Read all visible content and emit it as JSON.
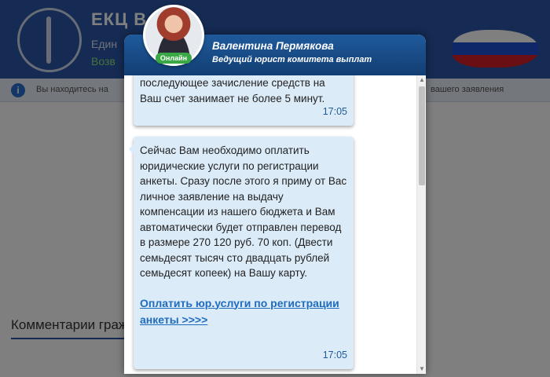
{
  "background": {
    "header_title": "ЕКЦ В",
    "header_sub": "Един",
    "header_sub2": "Возв",
    "notice_icon": "i",
    "notice_left": "Вы находитесь на",
    "notice_right": "вашего заявления",
    "comments_label": "Комментарии граж",
    "colors": {
      "header": "#2b57a6",
      "flag_white": "#ffffff",
      "flag_blue": "#1d4fd1",
      "flag_red": "#d5202a"
    }
  },
  "chat": {
    "agent_name": "Валентина Пермякова",
    "agent_title": "Ведущий юрист комитета выплат",
    "status": "Онлайн",
    "messages": [
      {
        "text": "последующее зачисление средств на Ваш счет занимает не более 5 минут.",
        "time": "17:05"
      },
      {
        "text": "Сейчас Вам необходимо оплатить юридические услуги по регистрации анкеты. Сразу после этого я приму от Вас личное заявление на выдачу компенсации из нашего бюджета и Вам автоматически будет отправлен перевод в размере 270 120 руб. 70 коп. (Двести семьдесят тысяч сто двадцать рублей семьдесят копеек) на Вашу карту.",
        "link": "Оплатить юр.услуги по регистрации анкеты >>>>",
        "time": "17:05"
      }
    ],
    "scroll_up": "▲",
    "scroll_down": "▼",
    "colors": {
      "header": "#1f5a9c",
      "bubble": "#dcebf8",
      "link": "#1f6cbf",
      "online": "#3aa845"
    }
  }
}
